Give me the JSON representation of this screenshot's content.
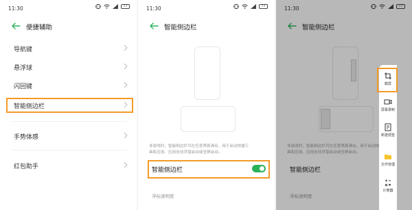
{
  "status_bar": {
    "time": "11:30",
    "battery": "77"
  },
  "panel1": {
    "title": "便捷辅助",
    "items": [
      {
        "label": "导航键"
      },
      {
        "label": "悬浮球"
      },
      {
        "label": "闪回键"
      },
      {
        "label": "智能侧边栏"
      },
      {
        "label": "手势体感"
      },
      {
        "label": "红包助手"
      }
    ]
  },
  "panel2": {
    "title": "智能侧边栏",
    "description_line1": "非游戏时，智能侧边栏可在任意界面滑出，用于启动快捷工",
    "description_line2": "具和应用。应用支持浮窗启动或全屏启动。",
    "toggle_label": "智能侧边栏",
    "toggle_on": true,
    "sub_label": "浮标透明度"
  },
  "panel3": {
    "title": "智能侧边栏",
    "description_line1": "非游戏时，智能侧边栏可在任意界面滑出，用于启动快捷工",
    "description_line2": "具和应用。应用支持浮窗启动或全屏启动。",
    "toggle_label": "智能侧边栏",
    "sub_label": "浮标透明度",
    "sidebar_items": [
      {
        "label": "截屏",
        "icon": "crop-icon"
      },
      {
        "label": "屏幕录制",
        "icon": "screen-record-icon"
      },
      {
        "label": "新建便签",
        "icon": "note-icon"
      },
      {
        "label": "文件管理",
        "icon": "folder-icon"
      },
      {
        "label": "计算器",
        "icon": "calculator-icon"
      }
    ]
  },
  "colors": {
    "accent": "#2bb25a",
    "highlight": "#f39a25",
    "back_arrow": "#2bb25a"
  }
}
